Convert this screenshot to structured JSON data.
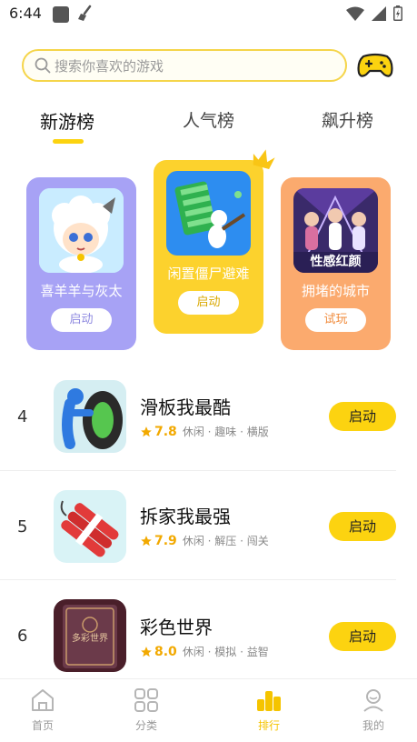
{
  "status_bar": {
    "time": "6:44"
  },
  "search": {
    "placeholder": "搜索你喜欢的游戏"
  },
  "tabs": [
    {
      "label": "新游榜",
      "active": true
    },
    {
      "label": "人气榜",
      "active": false
    },
    {
      "label": "飙升榜",
      "active": false
    }
  ],
  "podium": [
    {
      "rank": "2",
      "name": "喜羊羊与灰太",
      "button": "启动",
      "color": "#a7a2f5",
      "button_text_color": "#8f8ae0"
    },
    {
      "rank": "1",
      "name": "闲置僵尸避难",
      "button": "启动",
      "color": "#fcd22d",
      "button_text_color": "#d9a800"
    },
    {
      "rank": "3",
      "name": "拥堵的城市",
      "button": "试玩",
      "color": "#fbaa6e",
      "button_text_color": "#f08a3a"
    }
  ],
  "list": [
    {
      "rank": "4",
      "title": "滑板我最酷",
      "score": "7.8",
      "tags": "休闲 · 趣味 · 横版",
      "button": "启动"
    },
    {
      "rank": "5",
      "title": "拆家我最强",
      "score": "7.9",
      "tags": "休闲 · 解压 · 闯关",
      "button": "启动"
    },
    {
      "rank": "6",
      "title": "彩色世界",
      "score": "8.0",
      "tags": "休闲 · 模拟 · 益智",
      "button": "启动"
    }
  ],
  "list_extra": {
    "thumb3_text": "多彩世界"
  },
  "podium_extra": {
    "third_icon_text": "性感红颜"
  },
  "bottom_nav": [
    {
      "label": "首页",
      "icon": "home-icon",
      "active": false
    },
    {
      "label": "分类",
      "icon": "category-icon",
      "active": false
    },
    {
      "label": "排行",
      "icon": "rank-icon",
      "active": true
    },
    {
      "label": "我的",
      "icon": "profile-icon",
      "active": false
    }
  ],
  "colors": {
    "accent": "#fcd310",
    "active_nav": "#f5c400"
  }
}
